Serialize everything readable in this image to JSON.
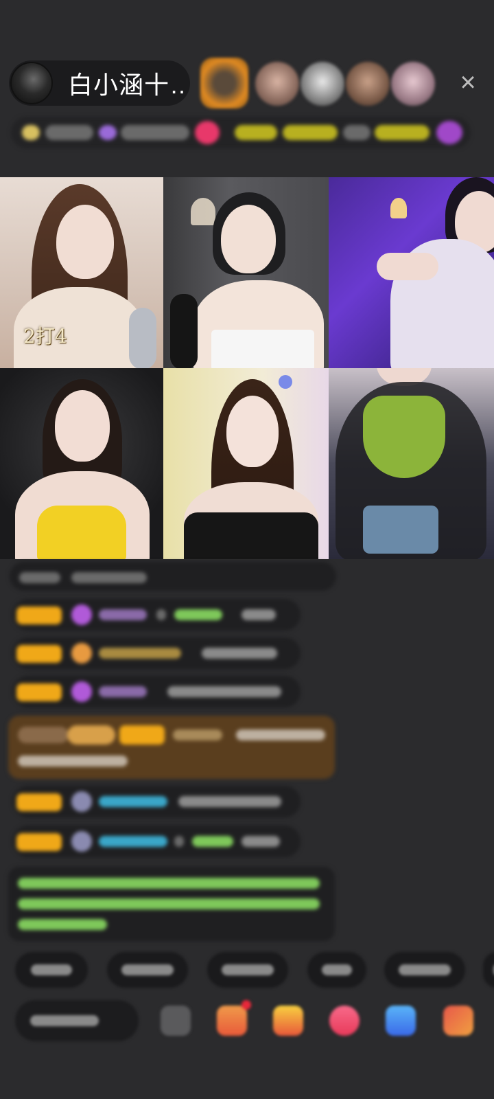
{
  "host": {
    "name": "白小涵十…"
  },
  "close_icon": "close-icon",
  "video_grid": {
    "tiles": [
      {
        "label": "2打4"
      },
      {
        "label": ""
      },
      {
        "label": ""
      },
      {
        "label": ""
      },
      {
        "label": ""
      },
      {
        "label": ""
      }
    ]
  },
  "colors": {
    "background": "#2b2b2d",
    "badge_yellow": "#f0a818",
    "chat_green": "#7ec85a",
    "chat_cyan": "#3aa6c8",
    "highlight_brown": "#5a3e1e"
  },
  "icons": [
    "close-icon",
    "gift-icon",
    "emoji-icon",
    "share-icon",
    "more-icon"
  ]
}
